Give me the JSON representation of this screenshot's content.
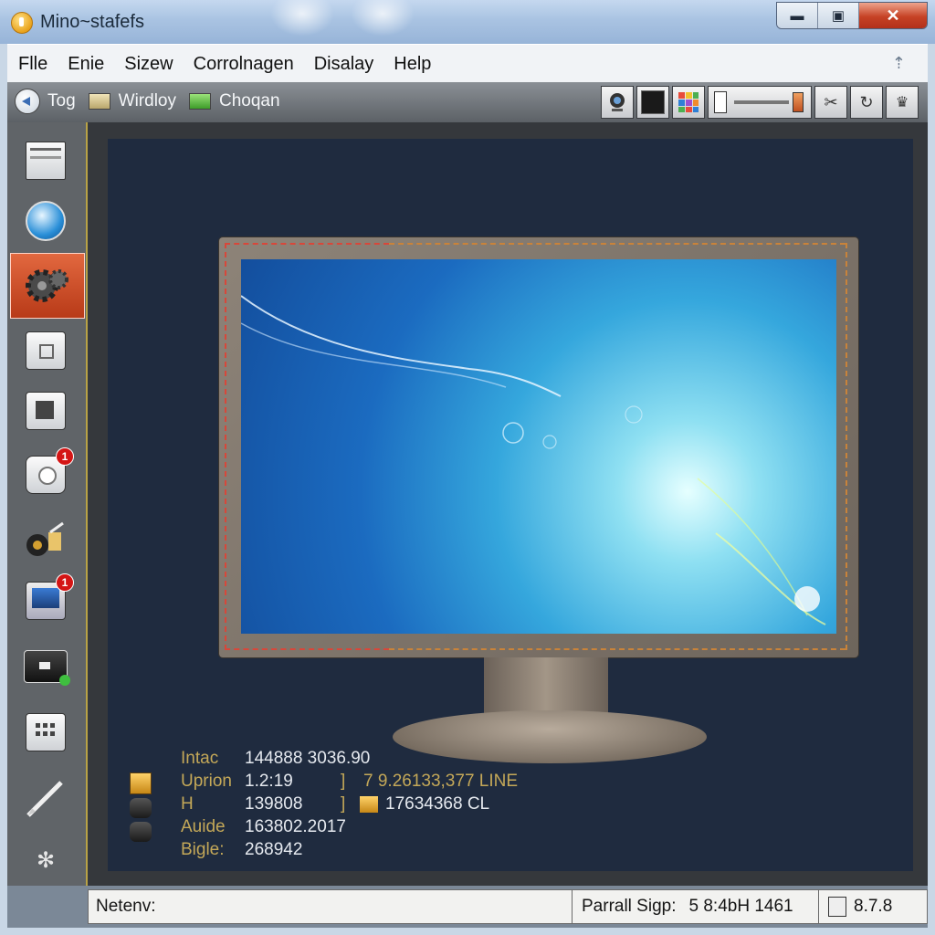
{
  "window": {
    "title": "Mino~stafefs",
    "buttons": {
      "minimize": "▬",
      "maximize": "▣",
      "close": "✕"
    }
  },
  "menu": {
    "items": [
      "Flle",
      "Enie",
      "Sizew",
      "Corrolnagen",
      "Disalay",
      "Help"
    ],
    "pin": "⇡"
  },
  "toolbar": {
    "left": [
      {
        "label": "Tog",
        "icon": "back-arrow-icon"
      },
      {
        "label": "Wirdloy",
        "icon": "window-icon"
      },
      {
        "label": "Choqan",
        "icon": "screen-icon"
      }
    ],
    "right_icons": [
      "webcam-icon",
      "black-square-icon",
      "color-grid-icon",
      "brightness-slider",
      "tools-icon",
      "refresh-icon",
      "crown-icon"
    ]
  },
  "sidebar": {
    "items": [
      {
        "icon": "window-settings-icon",
        "badge": ""
      },
      {
        "icon": "globe-icon",
        "badge": ""
      },
      {
        "icon": "gears-icon",
        "badge": "",
        "active": true
      },
      {
        "icon": "briefcase-icon",
        "badge": ""
      },
      {
        "icon": "chip-icon",
        "badge": ""
      },
      {
        "icon": "camera-icon",
        "badge": "1"
      },
      {
        "icon": "audio-icon",
        "badge": ""
      },
      {
        "icon": "monitor-icon",
        "badge": "1"
      },
      {
        "icon": "drive-icon",
        "badge": ""
      },
      {
        "icon": "calculator-icon",
        "badge": ""
      },
      {
        "icon": "pencil-icon",
        "badge": ""
      },
      {
        "icon": "asterisk-icon",
        "badge": ""
      }
    ]
  },
  "info": {
    "rows": [
      {
        "label": "Intac",
        "value": "144888 3036.90",
        "sep": "",
        "value2": ""
      },
      {
        "label": "Uprion",
        "value": "1.2:19",
        "sep": "]",
        "value2": "7 9.26133,377 LINE"
      },
      {
        "label": "H",
        "value": "139808",
        "sep": "]",
        "value2": "17634368 CL"
      },
      {
        "label": "Auide",
        "value": "163802.2017",
        "sep": "",
        "value2": ""
      },
      {
        "label": "Bigle:",
        "value": "268942",
        "sep": "",
        "value2": ""
      }
    ]
  },
  "status": {
    "left": "Netenv:",
    "middle_label": "Parrall Sigp:",
    "middle_value": "5 8:4bH 1461",
    "right": "8.7.8"
  }
}
